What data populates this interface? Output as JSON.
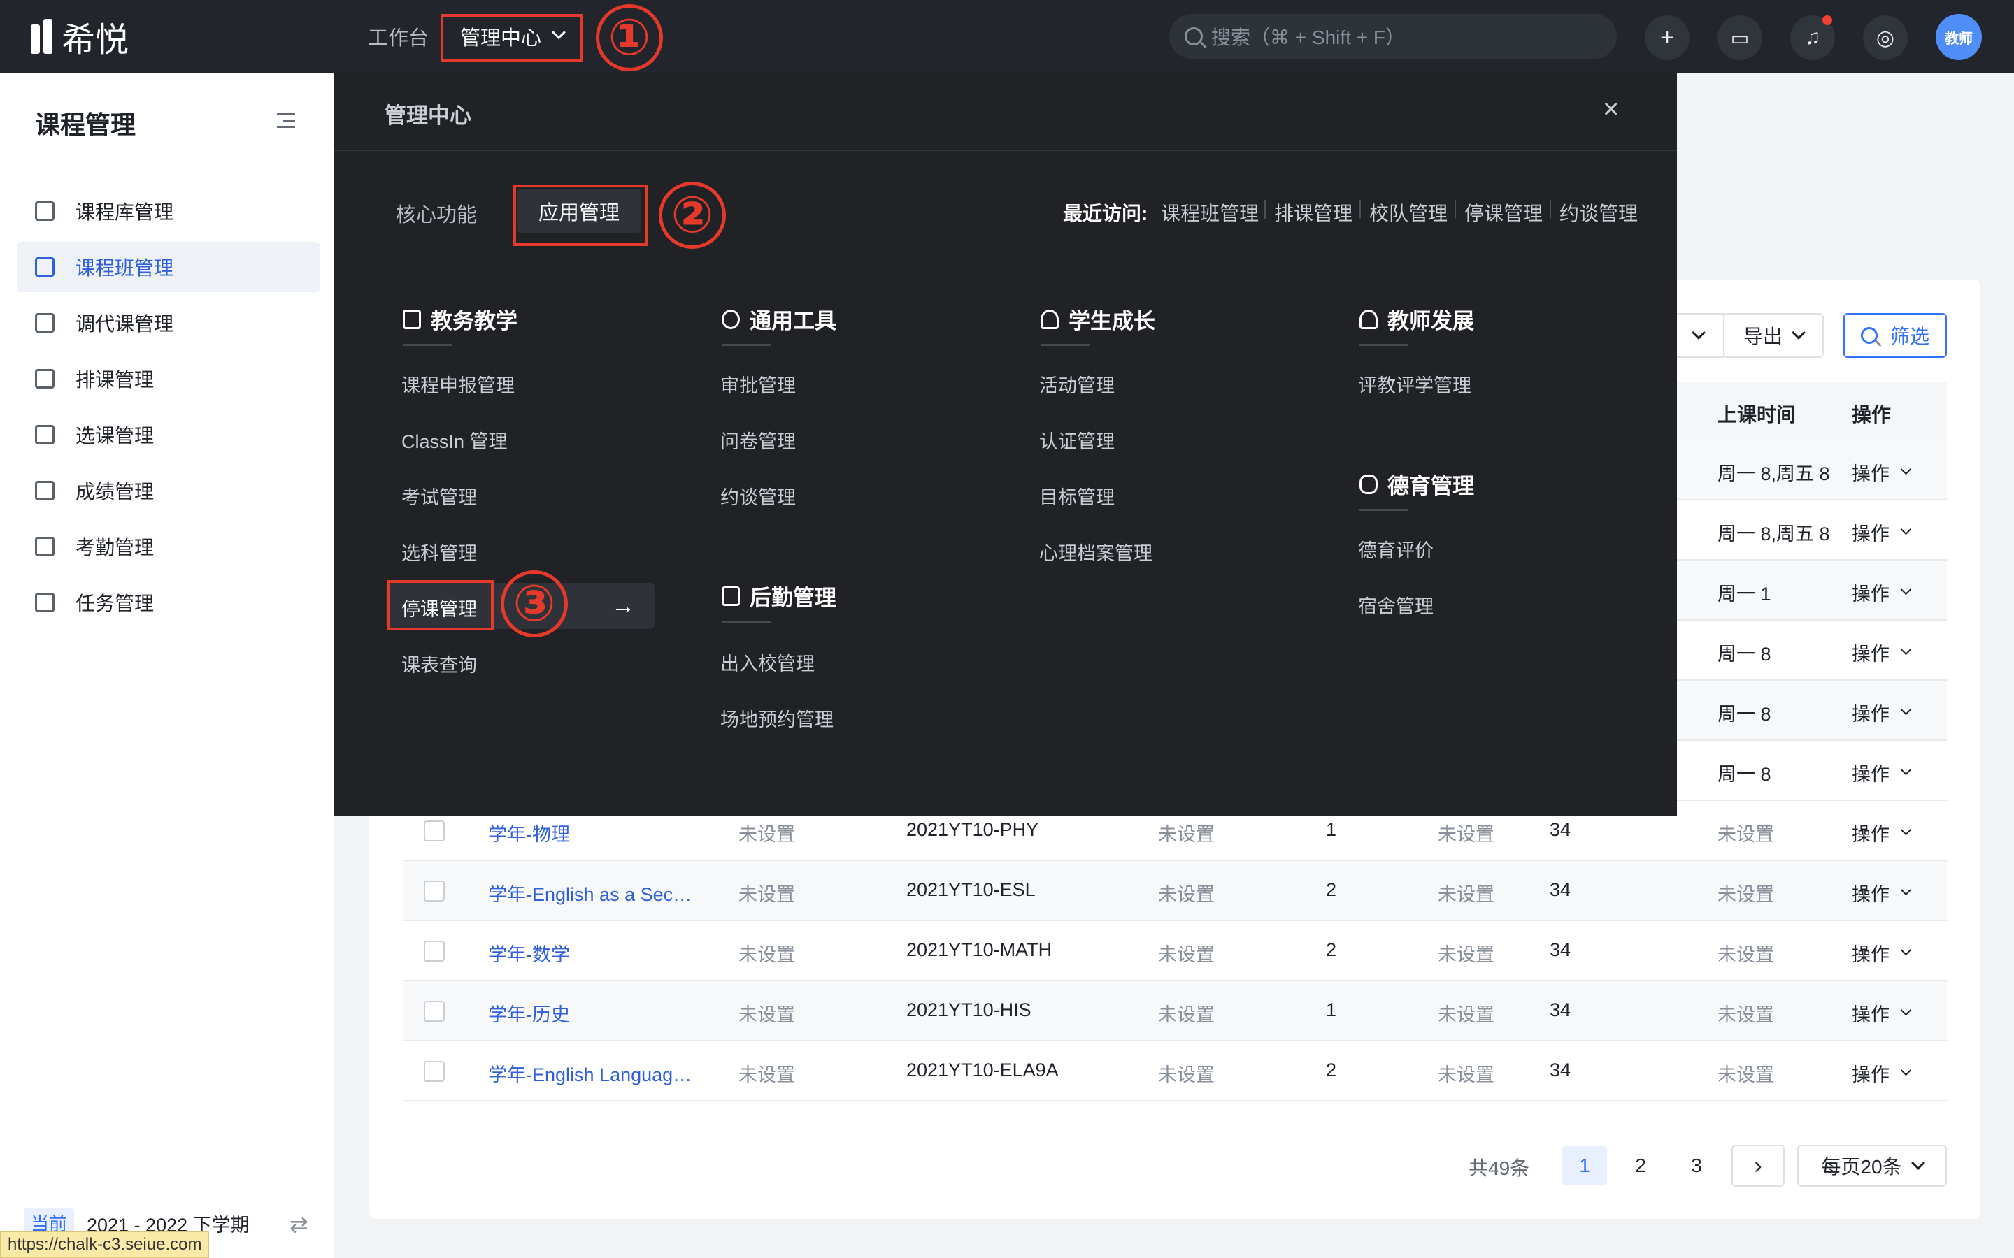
{
  "topbar": {
    "logo_text": "希悦",
    "nav": [
      {
        "label": "工作台"
      },
      {
        "label": "管理中心"
      }
    ],
    "search_placeholder": "搜索（⌘ + Shift + F）",
    "icons": [
      "plus-icon",
      "message-icon",
      "bell-icon",
      "help-icon"
    ],
    "avatar_text": "教师",
    "annotation_1": "①"
  },
  "sidebar": {
    "title": "课程管理",
    "items": [
      {
        "label": "课程库管理",
        "active": false
      },
      {
        "label": "课程班管理",
        "active": true
      },
      {
        "label": "调代课管理",
        "active": false
      },
      {
        "label": "排课管理",
        "active": false
      },
      {
        "label": "选课管理",
        "active": false
      },
      {
        "label": "成绩管理",
        "active": false
      },
      {
        "label": "考勤管理",
        "active": false
      },
      {
        "label": "任务管理",
        "active": false
      }
    ],
    "term_badge": "当前",
    "term": "2021 - 2022 下学期",
    "url_tip": "https://chalk-c3.seiue.com"
  },
  "toolbar": {
    "export_label": "导出",
    "filter_label": "筛选"
  },
  "table": {
    "headers": {
      "time": "上课时间",
      "op": "操作"
    },
    "op_label": "操作",
    "hidden_rows_visible": [
      {
        "time": "周一 8,周五 8"
      },
      {
        "time": "周一 8,周五 8"
      },
      {
        "time": "周一 1"
      },
      {
        "time": "周一 8"
      },
      {
        "time": "周一 8"
      },
      {
        "time": "周一 8"
      }
    ],
    "rows": [
      {
        "name": "学年-物理",
        "c2": "未设置",
        "code": "2021YT10-PHY",
        "c4": "未设置",
        "n": "1",
        "c6": "未设置",
        "count": "34",
        "time": "未设置"
      },
      {
        "name": "学年-English as a Sec…",
        "c2": "未设置",
        "code": "2021YT10-ESL",
        "c4": "未设置",
        "n": "2",
        "c6": "未设置",
        "count": "34",
        "time": "未设置"
      },
      {
        "name": "学年-数学",
        "c2": "未设置",
        "code": "2021YT10-MATH",
        "c4": "未设置",
        "n": "2",
        "c6": "未设置",
        "count": "34",
        "time": "未设置"
      },
      {
        "name": "学年-历史",
        "c2": "未设置",
        "code": "2021YT10-HIS",
        "c4": "未设置",
        "n": "1",
        "c6": "未设置",
        "count": "34",
        "time": "未设置"
      },
      {
        "name": "学年-English Languag…",
        "c2": "未设置",
        "code": "2021YT10-ELA9A",
        "c4": "未设置",
        "n": "2",
        "c6": "未设置",
        "count": "34",
        "time": "未设置"
      }
    ]
  },
  "pagination": {
    "total": "共49条",
    "pages": [
      "1",
      "2",
      "3"
    ],
    "next": "›",
    "page_size": "每页20条"
  },
  "panel": {
    "title": "管理中心",
    "close": "×",
    "tabs": [
      "核心功能",
      "应用管理"
    ],
    "annotation_2": "②",
    "annotation_3": "③",
    "recent_label": "最近访问:",
    "recent": [
      "课程班管理",
      "排课管理",
      "校队管理",
      "停课管理",
      "约谈管理"
    ],
    "arrow": "→",
    "categories": {
      "teaching": {
        "title": "教务教学",
        "items": [
          "课程申报管理",
          "ClassIn 管理",
          "考试管理",
          "选科管理",
          "停课管理",
          "课表查询"
        ]
      },
      "tools": {
        "title": "通用工具",
        "items": [
          "审批管理",
          "问卷管理",
          "约谈管理"
        ]
      },
      "logistics": {
        "title": "后勤管理",
        "items": [
          "出入校管理",
          "场地预约管理"
        ]
      },
      "growth": {
        "title": "学生成长",
        "items": [
          "活动管理",
          "认证管理",
          "目标管理",
          "心理档案管理"
        ]
      },
      "teacher": {
        "title": "教师发展",
        "items": [
          "评教评学管理"
        ]
      },
      "moral": {
        "title": "德育管理",
        "items": [
          "德育评价",
          "宿舍管理"
        ]
      }
    }
  }
}
